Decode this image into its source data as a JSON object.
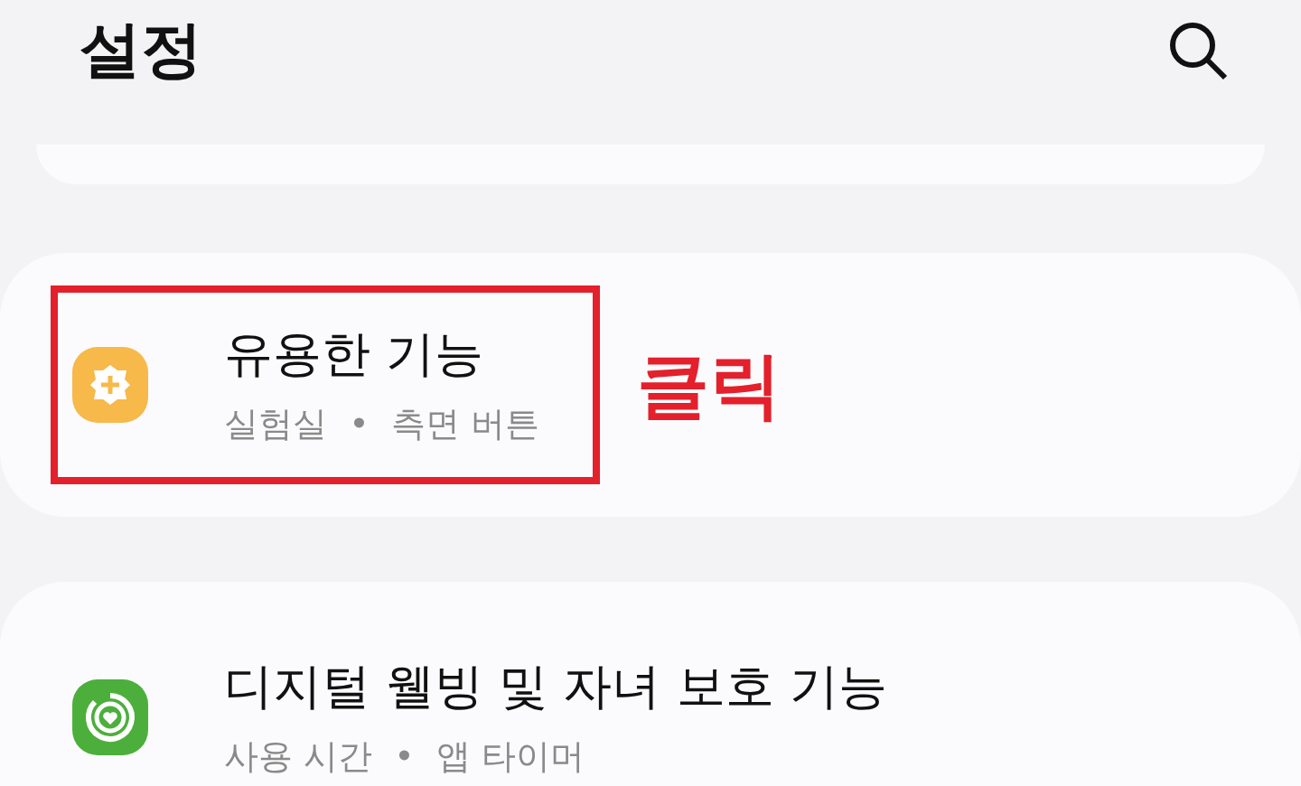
{
  "header": {
    "title": "설정"
  },
  "items": [
    {
      "kind": "labs",
      "title": "유용한 기능",
      "subtitle": "실험실  •  측면 버튼",
      "highlighted": true,
      "callout": "클릭"
    },
    {
      "kind": "wellbeing",
      "title": "디지털 웰빙 및 자녀 보호 기능",
      "subtitle": "사용 시간  •  앱 타이머",
      "highlighted": false
    }
  ]
}
